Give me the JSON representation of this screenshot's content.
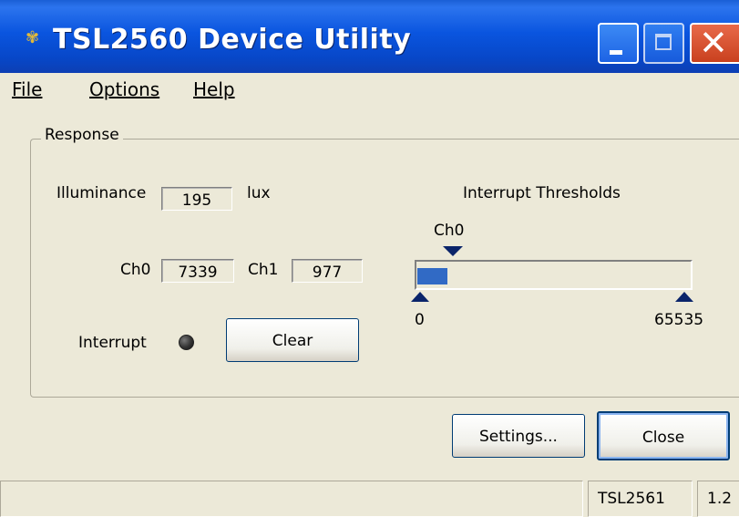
{
  "window": {
    "title": "TSL2560 Device Utility",
    "icon": "app-icon"
  },
  "menu": {
    "file": "File",
    "options": "Options",
    "help": "Help"
  },
  "response": {
    "group_label": "Response",
    "illuminance_label": "Illuminance",
    "illuminance_value": "195",
    "illuminance_unit": "lux",
    "ch0_label": "Ch0",
    "ch0_value": "7339",
    "ch1_label": "Ch1",
    "ch1_value": "977",
    "interrupt_label": "Interrupt",
    "clear_button": "Clear"
  },
  "thresholds": {
    "title": "Interrupt Thresholds",
    "marker_label": "Ch0",
    "min_label": "0",
    "max_label": "65535",
    "ch0_level": 7339,
    "range": [
      0,
      65535
    ],
    "fill_color": "#316ac5"
  },
  "buttons": {
    "settings": "Settings...",
    "close": "Close"
  },
  "statusbar": {
    "message": "",
    "device": "TSL2561",
    "version": "1.2"
  }
}
